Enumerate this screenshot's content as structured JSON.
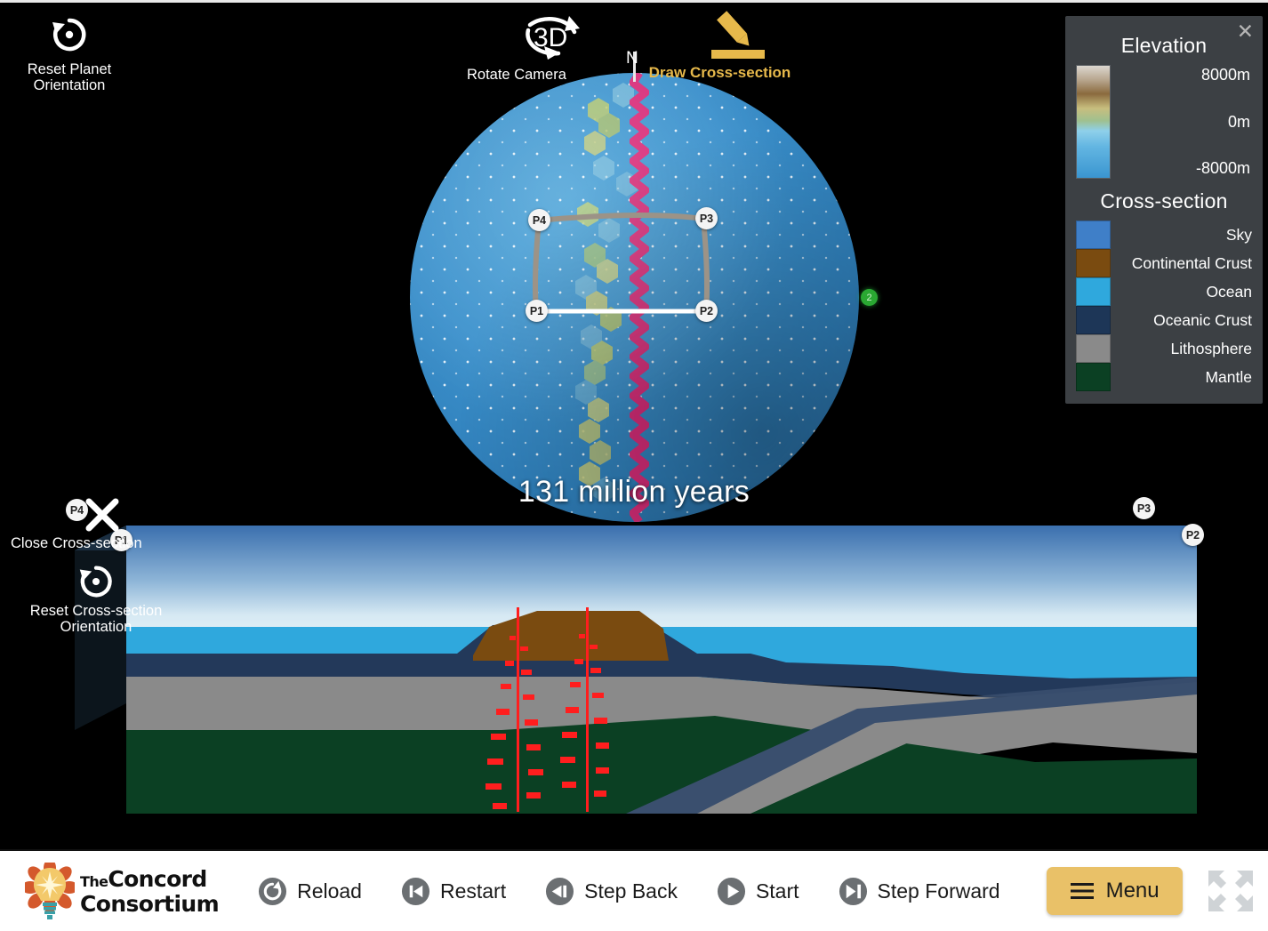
{
  "app": {
    "time_label": "131 million years",
    "north_label": "N",
    "globe_badge": "2"
  },
  "tools": {
    "reset_planet": {
      "label": "Reset Planet\nOrientation",
      "icon": "reset-rotation-icon"
    },
    "rotate_camera": {
      "label": "Rotate Camera",
      "icon": "3d-rotate-icon",
      "icon_text": "3D"
    },
    "draw_cross_section": {
      "label": "Draw Cross-section",
      "icon": "pencil-icon",
      "color": "#e7b94b"
    },
    "close_cross_section": {
      "label": "Close Cross-section",
      "icon": "close-x-icon"
    },
    "reset_cross_section": {
      "label": "Reset Cross-section\nOrientation",
      "icon": "reset-rotation-icon"
    }
  },
  "cross_section_points": [
    {
      "id": "P1",
      "label": "P1"
    },
    {
      "id": "P2",
      "label": "P2"
    },
    {
      "id": "P3",
      "label": "P3"
    },
    {
      "id": "P4",
      "label": "P4"
    }
  ],
  "legend": {
    "close_icon": "close-icon",
    "elevation": {
      "title": "Elevation",
      "ticks": [
        "8000m",
        "0m",
        "-8000m"
      ],
      "gradient_stops": [
        "#dcd7d0",
        "#b6a48c",
        "#8a6a3e",
        "#c8be7e",
        "#9fc08f",
        "#8fd0ea",
        "#63b6e2",
        "#3a95d0"
      ]
    },
    "cross_section": {
      "title": "Cross-section",
      "items": [
        {
          "label": "Sky",
          "color": "#3f7fc8"
        },
        {
          "label": "Continental Crust",
          "color": "#7a4b10"
        },
        {
          "label": "Ocean",
          "color": "#2fa8dd"
        },
        {
          "label": "Oceanic Crust",
          "color": "#1d3657"
        },
        {
          "label": "Lithosphere",
          "color": "#8a8a8a"
        },
        {
          "label": "Mantle",
          "color": "#0b4023"
        }
      ]
    }
  },
  "toolbar": {
    "logo": {
      "line1_the": "The",
      "line1": "Concord",
      "line2": "Consortium"
    },
    "controls": [
      {
        "label": "Reload",
        "icon": "reload-icon"
      },
      {
        "label": "Restart",
        "icon": "skip-back-icon"
      },
      {
        "label": "Step Back",
        "icon": "step-back-icon"
      },
      {
        "label": "Start",
        "icon": "play-icon"
      },
      {
        "label": "Step Forward",
        "icon": "step-forward-icon"
      }
    ],
    "menu": {
      "label": "Menu",
      "icon": "hamburger-icon",
      "color": "#e9c168"
    },
    "fullscreen": {
      "icon": "fullscreen-icon"
    }
  }
}
